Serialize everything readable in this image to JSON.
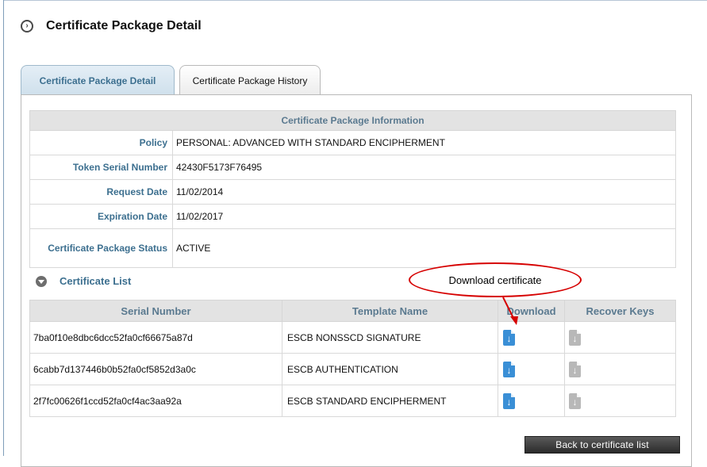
{
  "page": {
    "title": "Certificate Package Detail"
  },
  "tabs": [
    {
      "label": "Certificate Package Detail",
      "active": true
    },
    {
      "label": "Certificate Package History",
      "active": false
    }
  ],
  "package_info": {
    "heading": "Certificate Package Information",
    "rows": [
      {
        "label": "Policy",
        "value": "PERSONAL: ADVANCED WITH STANDARD ENCIPHERMENT"
      },
      {
        "label": "Token Serial Number",
        "value": "42430F5173F76495"
      },
      {
        "label": "Request Date",
        "value": "11/02/2014"
      },
      {
        "label": "Expiration Date",
        "value": "11/02/2017"
      },
      {
        "label": "Certificate Package Status",
        "value": "ACTIVE"
      }
    ]
  },
  "certificate_list": {
    "title": "Certificate List",
    "columns": [
      "Serial Number",
      "Template Name",
      "Download",
      "Recover Keys"
    ],
    "rows": [
      {
        "serial": "7ba0f10e8dbc6dcc52fa0cf66675a87d",
        "template": "ESCB NONSSCD SIGNATURE"
      },
      {
        "serial": "6cabb7d137446b0b52fa0cf5852d3a0c",
        "template": "ESCB AUTHENTICATION"
      },
      {
        "serial": "2f7fc00626f1ccd52fa0cf4ac3aa92a",
        "template": "ESCB STANDARD ENCIPHERMENT"
      }
    ]
  },
  "back_button": {
    "label": "Back to certificate list"
  },
  "annotation": {
    "text": "Download certificate"
  },
  "colors": {
    "accent": "#3c6f8f",
    "download_icon": "#3a8fd6",
    "recover_icon": "#b8b8b8",
    "callout": "#d60000"
  }
}
